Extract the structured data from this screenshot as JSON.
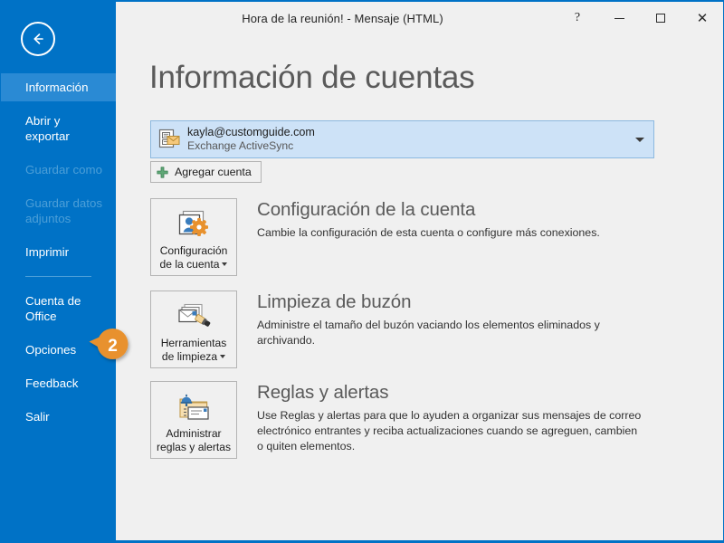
{
  "window": {
    "title": "Hora de la reunión! - Mensaje (HTML)",
    "help_label": "?",
    "minimize_label": "",
    "maximize_label": "",
    "close_label": "✕",
    "accent_color": "#0072c6"
  },
  "sidebar": {
    "back_label": "back-arrow",
    "items": [
      {
        "label": "Información",
        "state": "selected"
      },
      {
        "label": "Abrir y exportar",
        "state": "normal"
      },
      {
        "label": "Guardar como",
        "state": "disabled"
      },
      {
        "label": "Guardar datos adjuntos",
        "state": "disabled"
      },
      {
        "label": "Imprimir",
        "state": "normal"
      },
      {
        "label": "Cuenta de Office",
        "state": "normal"
      },
      {
        "label": "Opciones",
        "state": "normal"
      },
      {
        "label": "Feedback",
        "state": "normal"
      },
      {
        "label": "Salir",
        "state": "normal"
      }
    ]
  },
  "callout": {
    "number": "2",
    "color": "#e8912d"
  },
  "main": {
    "title": "Información de cuentas",
    "account": {
      "email": "kayla@customguide.com",
      "type": "Exchange ActiveSync",
      "icon": "account-mail-icon"
    },
    "add_account": {
      "label": "Agregar cuenta",
      "icon": "plus-icon"
    },
    "features": [
      {
        "button_label": "Configuración de la cuenta",
        "heading": "Configuración de la cuenta",
        "description": "Cambie la configuración de esta cuenta o configure más conexiones.",
        "icon": "account-settings-icon",
        "has_dropdown": true
      },
      {
        "button_label": "Herramientas de limpieza",
        "heading": "Limpieza de buzón",
        "description": "Administre el tamaño del buzón vaciando los elementos eliminados y archivando.",
        "icon": "mailbox-cleanup-icon",
        "has_dropdown": true
      },
      {
        "button_label": "Administrar reglas y alertas",
        "heading": "Reglas y alertas",
        "description": "Use Reglas y alertas para que lo ayuden a organizar sus mensajes de correo electrónico entrantes y reciba actualizaciones cuando se agreguen, cambien o quiten elementos.",
        "icon": "rules-alerts-icon",
        "has_dropdown": false
      }
    ]
  }
}
